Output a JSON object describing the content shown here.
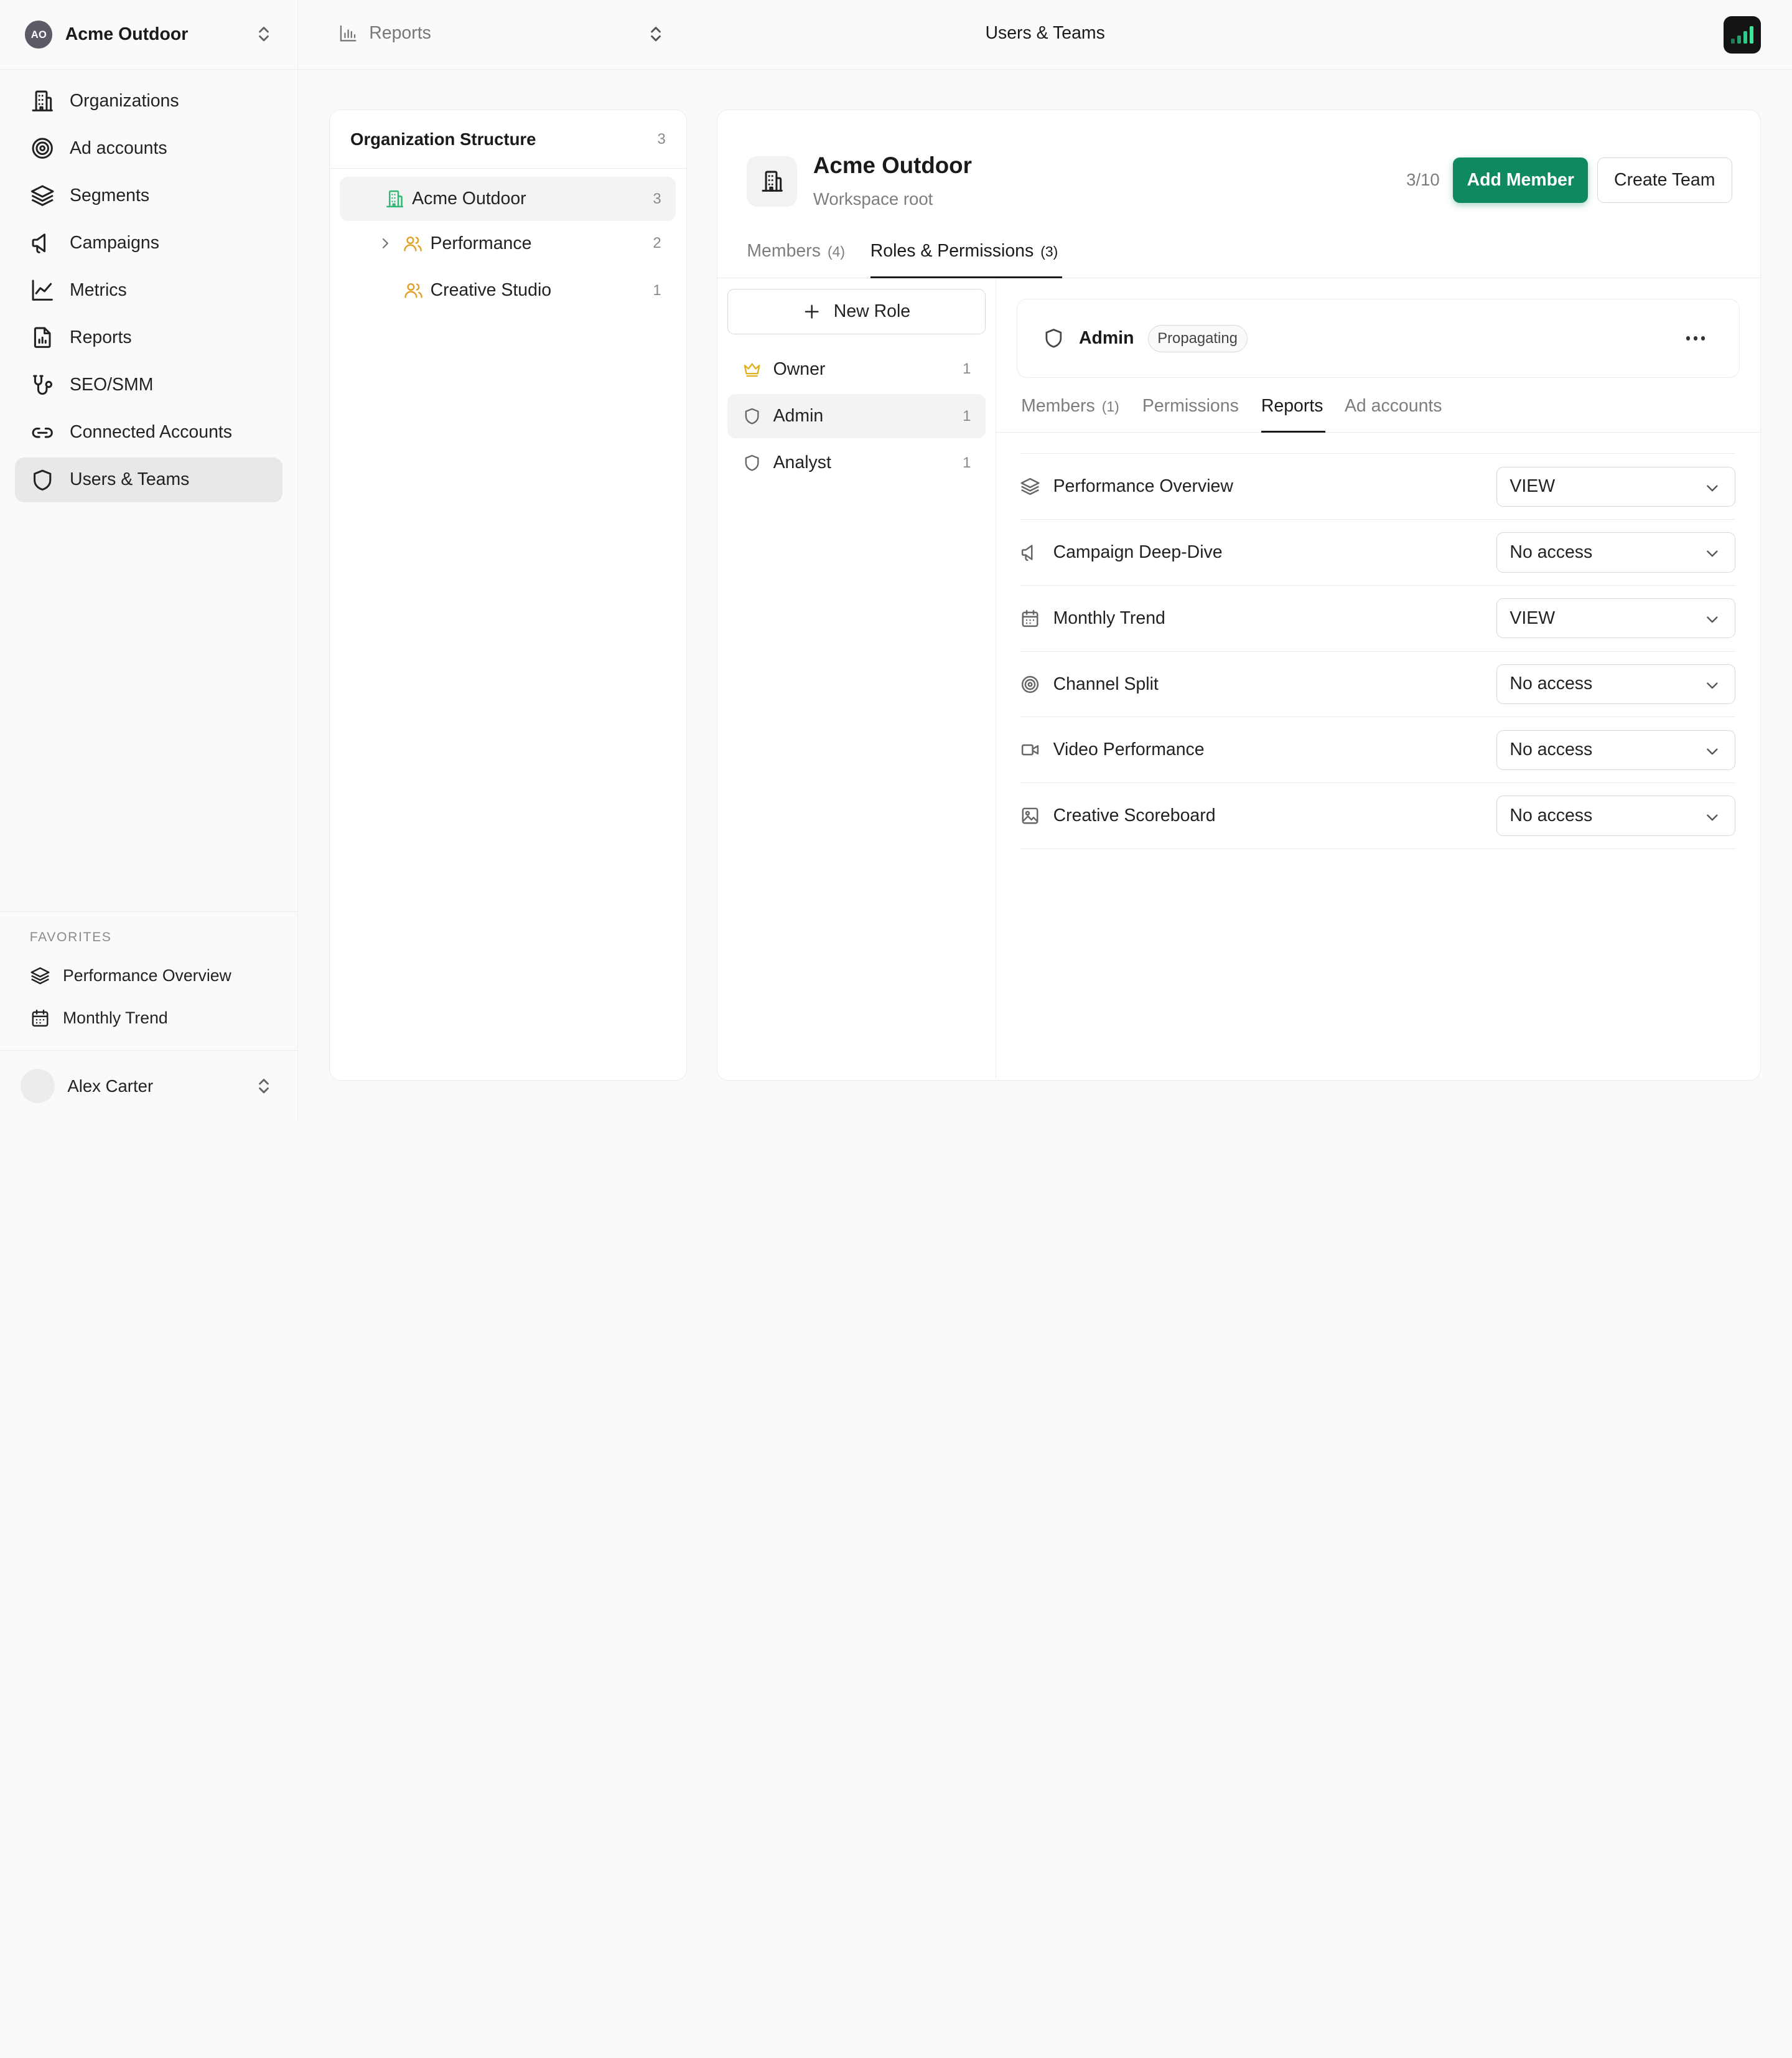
{
  "workspace": {
    "initials": "AO",
    "name": "Acme Outdoor"
  },
  "sidebar": {
    "items": [
      {
        "label": "Organizations",
        "icon": "building-icon"
      },
      {
        "label": "Ad accounts",
        "icon": "target-icon"
      },
      {
        "label": "Segments",
        "icon": "layers-icon"
      },
      {
        "label": "Campaigns",
        "icon": "megaphone-icon"
      },
      {
        "label": "Metrics",
        "icon": "line-chart-icon"
      },
      {
        "label": "Reports",
        "icon": "report-icon"
      },
      {
        "label": "SEO/SMM",
        "icon": "seo-icon"
      },
      {
        "label": "Connected Accounts",
        "icon": "link-icon"
      },
      {
        "label": "Users & Teams",
        "icon": "shield-icon",
        "active": true
      }
    ],
    "favorites_title": "FAVORITES",
    "favorites": [
      {
        "label": "Performance Overview",
        "icon": "layers-icon"
      },
      {
        "label": "Monthly Trend",
        "icon": "calendar-icon"
      }
    ],
    "user": {
      "name": "Alex Carter"
    }
  },
  "topbar": {
    "report_label": "Reports",
    "title": "Users & Teams"
  },
  "org_structure": {
    "title": "Organization Structure",
    "count": "3",
    "tree": [
      {
        "label": "Acme Outdoor",
        "count": "3",
        "selected": true
      },
      {
        "label": "Performance",
        "count": "2"
      },
      {
        "label": "Creative Studio",
        "count": "1"
      }
    ]
  },
  "entity": {
    "name": "Acme Outdoor",
    "subtitle": "Workspace root",
    "quota": "3/10",
    "add_member_label": "Add Member",
    "create_team_label": "Create Team"
  },
  "main_tabs": [
    {
      "label": "Members",
      "count": "(4)"
    },
    {
      "label": "Roles & Permissions",
      "count": "(3)",
      "active": true
    }
  ],
  "roles": {
    "new_role_label": "New Role",
    "items": [
      {
        "label": "Owner",
        "count": "1",
        "icon": "crown-icon"
      },
      {
        "label": "Admin",
        "count": "1",
        "icon": "shield-icon",
        "selected": true
      },
      {
        "label": "Analyst",
        "count": "1",
        "icon": "shield-icon"
      }
    ]
  },
  "role_detail": {
    "name": "Admin",
    "badge": "Propagating",
    "tabs": [
      {
        "label": "Members",
        "count": "(1)"
      },
      {
        "label": "Permissions",
        "count": ""
      },
      {
        "label": "Reports",
        "count": "",
        "active": true
      },
      {
        "label": "Ad accounts",
        "count": ""
      }
    ],
    "reports": [
      {
        "label": "Performance Overview",
        "access": "VIEW",
        "icon": "layers-icon"
      },
      {
        "label": "Campaign Deep-Dive",
        "access": "No access",
        "icon": "megaphone-icon"
      },
      {
        "label": "Monthly Trend",
        "access": "VIEW",
        "icon": "calendar-icon"
      },
      {
        "label": "Channel Split",
        "access": "No access",
        "icon": "target-icon"
      },
      {
        "label": "Video Performance",
        "access": "No access",
        "icon": "video-icon"
      },
      {
        "label": "Creative Scoreboard",
        "access": "No access",
        "icon": "image-icon"
      }
    ]
  },
  "colors": {
    "accent": "#0f8a5f",
    "tree_icon_green": "#2eb872",
    "team_icon_orange": "#e0a12b"
  }
}
